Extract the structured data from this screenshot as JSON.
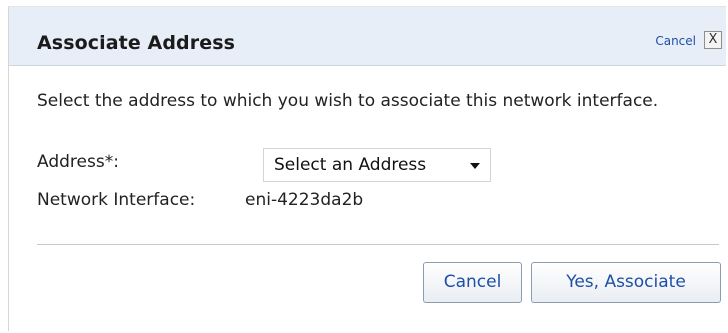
{
  "dialog": {
    "title": "Associate Address",
    "header_cancel": "Cancel",
    "close_glyph": "X",
    "description": "Select the address to which you wish to associate this network interface.",
    "address_label": "Address*:",
    "address_select": {
      "selected": "Select an Address"
    },
    "network_interface_label": "Network Interface:",
    "network_interface_value": "eni-4223da2b",
    "buttons": {
      "cancel": "Cancel",
      "confirm": "Yes, Associate"
    }
  },
  "colors": {
    "header_bg": "#e7eef8",
    "link": "#1d4fa8"
  }
}
